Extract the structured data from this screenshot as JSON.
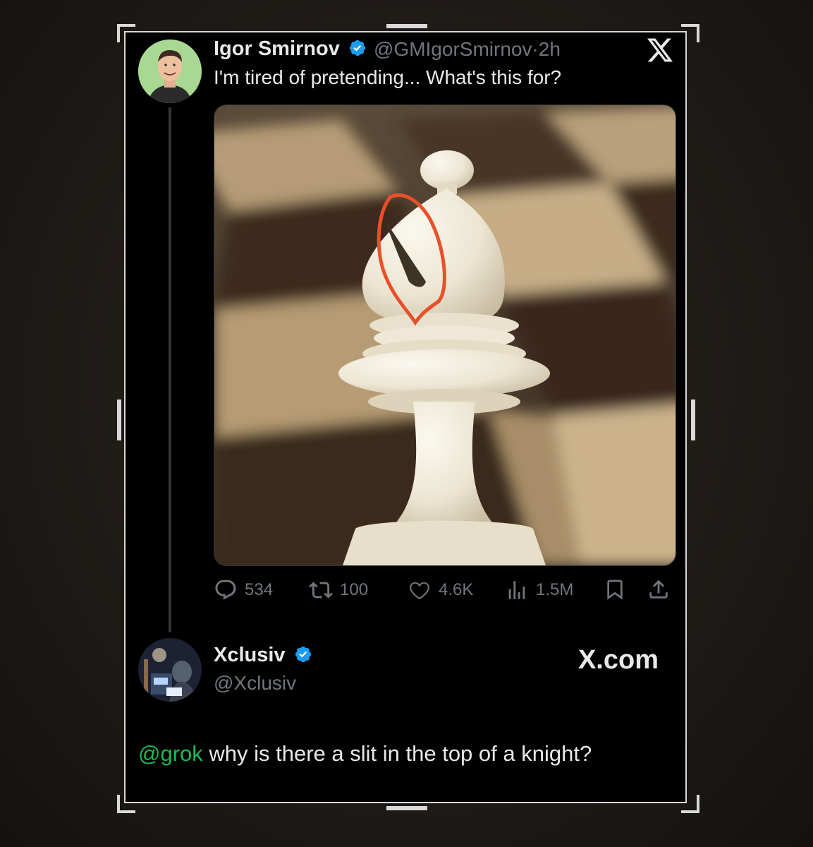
{
  "tweet": {
    "author_name": "Igor Smirnov",
    "author_handle": "@GMIgorSmirnov",
    "separator": "·",
    "time": "2h",
    "text": "I'm tired of pretending... What's this for?",
    "stats": {
      "replies": "534",
      "reposts": "100",
      "likes": "4.6K",
      "views": "1.5M"
    }
  },
  "reply": {
    "author_name": "Xclusiv",
    "author_handle": "@Xclusiv",
    "mention": "@grok",
    "text": " why is there a slit in the top of a knight?"
  },
  "branding": {
    "x_com": "X.com"
  },
  "colors": {
    "verified": "#1d9bf0",
    "mention": "#1db954",
    "annotation": "#e8502a"
  },
  "icons": [
    "x-logo-icon",
    "verified-badge-icon",
    "reply-icon",
    "repost-icon",
    "like-icon",
    "views-icon",
    "bookmark-icon",
    "share-icon"
  ]
}
